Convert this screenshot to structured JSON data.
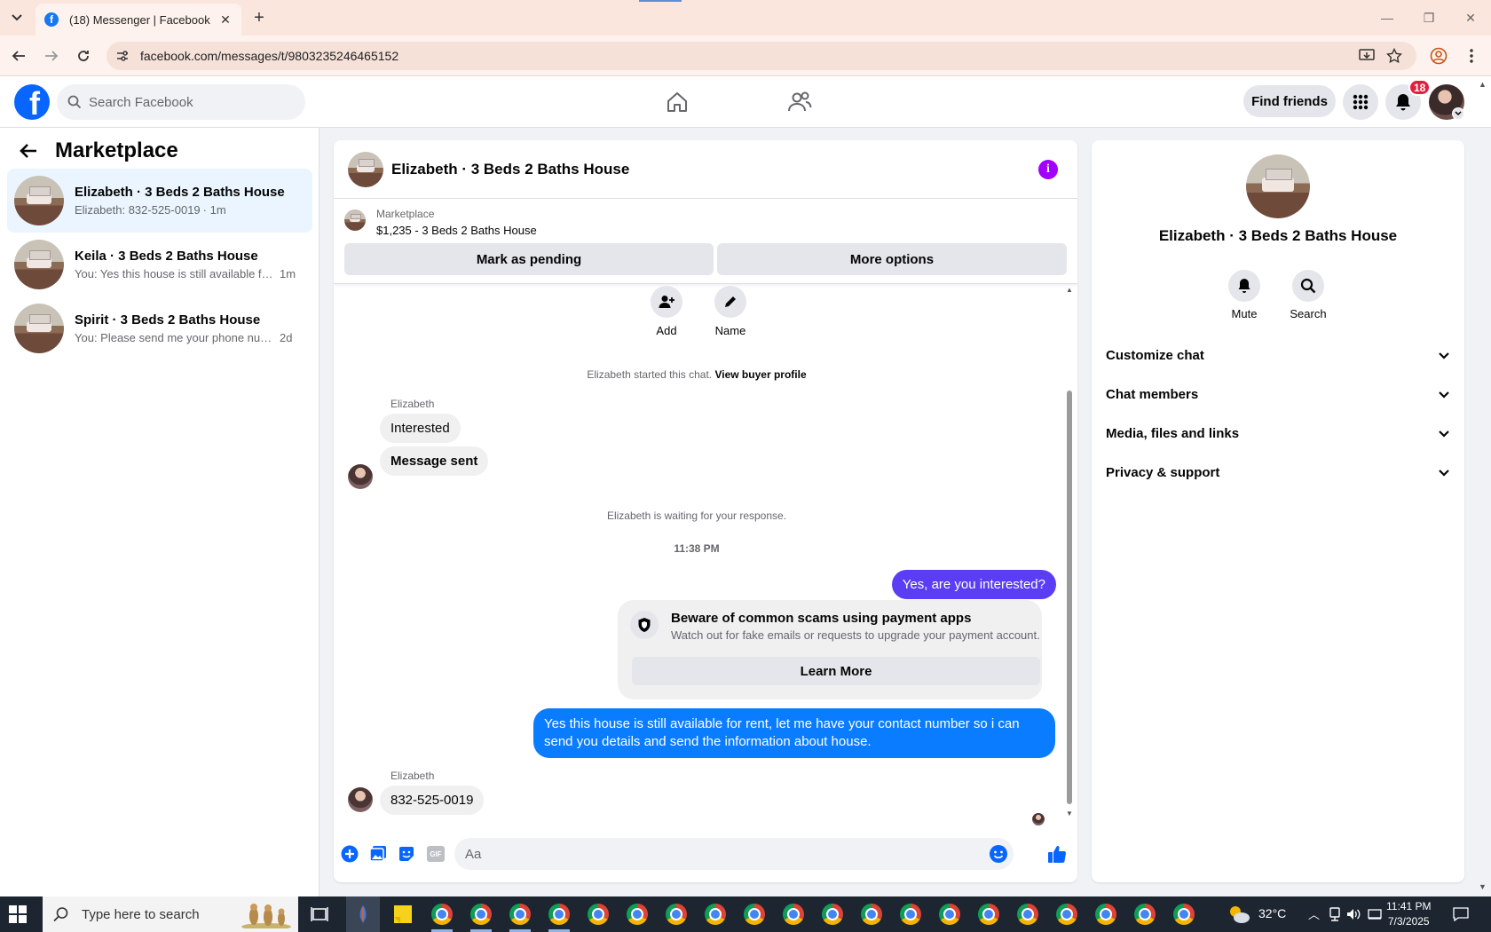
{
  "browser": {
    "tab_title": "(18) Messenger | Facebook",
    "url": "facebook.com/messages/t/9803235246465152"
  },
  "header": {
    "search_placeholder": "Search Facebook",
    "find_friends": "Find friends",
    "notification_count": "18"
  },
  "sidebar": {
    "title": "Marketplace",
    "conversations": [
      {
        "name": "Elizabeth · 3 Beds 2 Baths House",
        "preview": "Elizabeth: 832-525-0019",
        "time": "· 1m",
        "active": true
      },
      {
        "name": "Keila · 3 Beds 2 Baths House",
        "preview": "You: Yes this house is still available fo...",
        "time": "1m",
        "active": false
      },
      {
        "name": "Spirit · 3 Beds 2 Baths House",
        "preview": "You: Please send me your phone num...",
        "time": "2d",
        "active": false
      }
    ]
  },
  "chat": {
    "title": "Elizabeth · 3 Beds 2 Baths House",
    "listing_label": "Marketplace",
    "listing_price": "$1,235 - 3 Beds 2 Baths House",
    "mark_pending": "Mark as pending",
    "more_options": "More options",
    "actions": {
      "add": "Add",
      "name": "Name"
    },
    "started": "Elizabeth started this chat.",
    "view_profile": "View buyer profile",
    "sender": "Elizabeth",
    "msg_interested": "Interested",
    "msg_sent": "Message sent",
    "waiting": "Elizabeth is waiting for your response.",
    "timestamp": "11:38 PM",
    "out_1": "Yes, are you interested?",
    "scam_title": "Beware of common scams using payment apps",
    "scam_desc": "Watch out for fake emails or requests to upgrade your payment account.",
    "learn_more": "Learn More",
    "out_2": "Yes this house is still available for rent, let me have your contact number so i can send you details and send the information about house.",
    "sender_2": "Elizabeth",
    "msg_phone": "832-525-0019",
    "composer_placeholder": "Aa",
    "gif_label": "GIF"
  },
  "info_panel": {
    "name": "Elizabeth · 3 Beds 2 Baths House",
    "mute": "Mute",
    "search": "Search",
    "sections": [
      "Customize chat",
      "Chat members",
      "Media, files and links",
      "Privacy & support"
    ]
  },
  "taskbar": {
    "search_text": "Type here to search",
    "temperature": "32°C",
    "time": "11:41 PM",
    "date": "7/3/2025"
  },
  "colors": {
    "facebook_blue": "#0866ff",
    "outgoing_purple": "#5b3df5",
    "outgoing_blue": "#0a7cff",
    "info_purple": "#a100ff"
  }
}
